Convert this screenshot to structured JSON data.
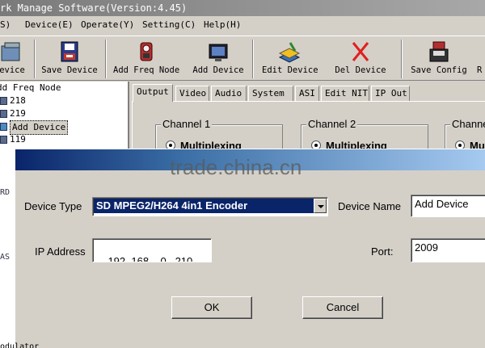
{
  "window": {
    "title": "rk Manage Software(Version:4.45)"
  },
  "menu": [
    {
      "label": "S)"
    },
    {
      "label": "Device(E)"
    },
    {
      "label": "Operate(Y)"
    },
    {
      "label": "Setting(C)"
    },
    {
      "label": "Help(H)"
    }
  ],
  "toolbar": {
    "items": [
      {
        "label": "evice",
        "icon": "device-icon"
      },
      {
        "label": "Save Device",
        "icon": "save-device-icon"
      },
      {
        "label": "Add Freq Node",
        "icon": "add-freq-node-icon"
      },
      {
        "label": "Add Device",
        "icon": "add-device-icon"
      },
      {
        "label": "Edit Device",
        "icon": "edit-device-icon"
      },
      {
        "label": "Del Device",
        "icon": "delete-icon"
      },
      {
        "label": "Save Config",
        "icon": "save-config-icon"
      },
      {
        "label": "R",
        "icon": ""
      }
    ]
  },
  "tree": {
    "items": [
      {
        "label": "dd Freq Node"
      },
      {
        "label": "218"
      },
      {
        "label": "219"
      },
      {
        "label": "Add Device"
      },
      {
        "label": "119"
      }
    ],
    "side_marks": [
      "RD",
      "AS"
    ],
    "bottom_text": "odulator"
  },
  "tabs": [
    {
      "label": "Output"
    },
    {
      "label": "Video"
    },
    {
      "label": "Audio"
    },
    {
      "label": "System"
    },
    {
      "label": "ASI"
    },
    {
      "label": "Edit NIT"
    },
    {
      "label": "IP Out"
    }
  ],
  "channels": [
    {
      "title": "Channel 1",
      "mode": "Multiplexing"
    },
    {
      "title": "Channel 2",
      "mode": "Multiplexing"
    },
    {
      "title": "Channe",
      "mode": "Mu"
    }
  ],
  "dialog": {
    "device_type_label": "Device Type",
    "device_type_value": "SD MPEG2/H264 4in1 Encoder",
    "device_name_label": "Device Name",
    "device_name_value": "Add Device",
    "ip_label": "IP Address",
    "ip_value": "192 .168 .  0  .210",
    "port_label": "Port:",
    "port_value": "2009",
    "ok_label": "OK",
    "cancel_label": "Cancel"
  },
  "watermark": "trade.china.cn",
  "colors": {
    "dialog_title_start": "#0a246a",
    "dialog_title_end": "#a6caf0",
    "selection": "#0a246a",
    "face": "#d4d0c8"
  }
}
